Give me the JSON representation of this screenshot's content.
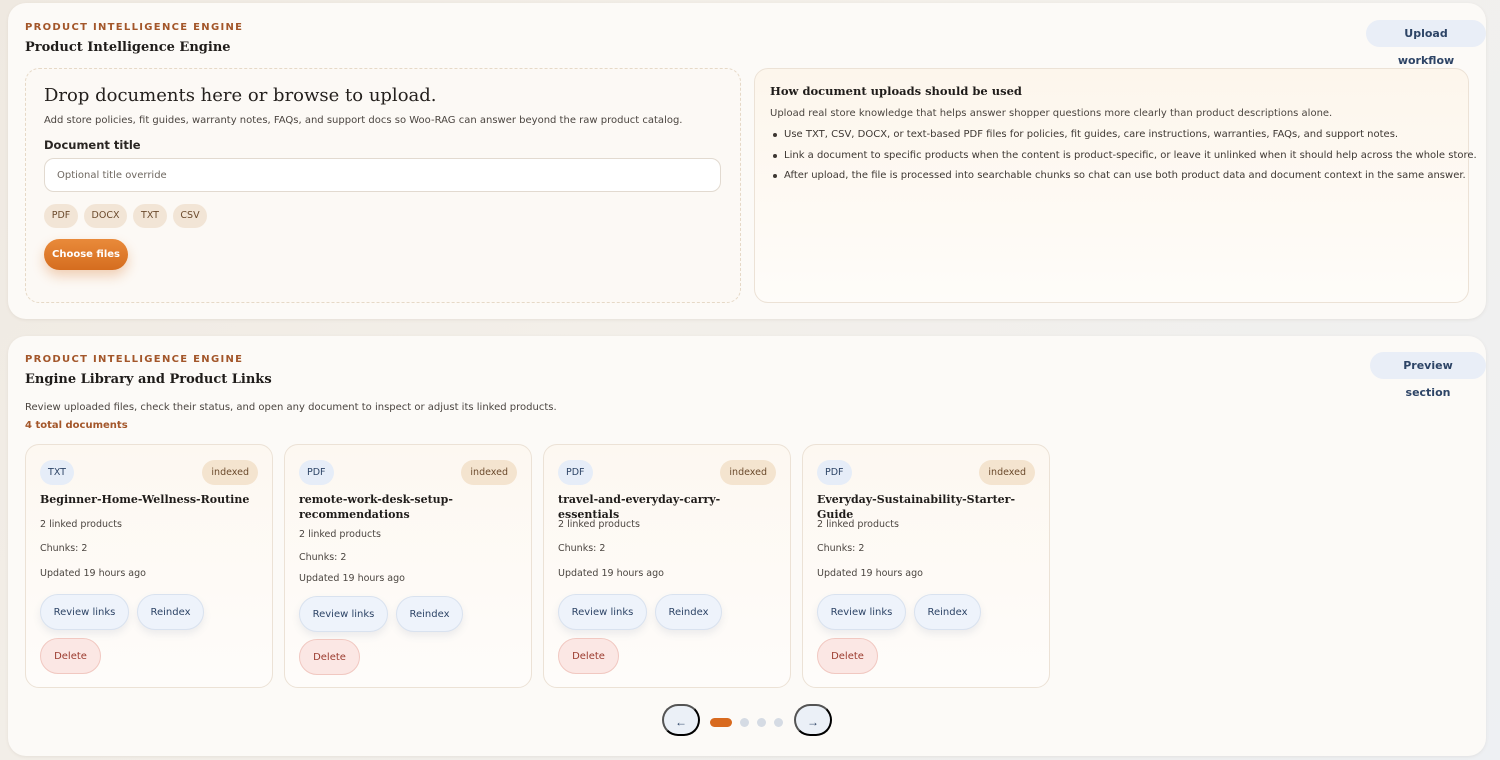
{
  "upload_panel": {
    "eyebrow": "PRODUCT INTELLIGENCE ENGINE",
    "title": "Product Intelligence Engine",
    "workflow_button": "Upload workflow",
    "dropzone": {
      "heading": "Drop documents here or browse to upload.",
      "description": "Add store policies, fit guides, warranty notes, FAQs, and support docs so Woo-RAG can answer beyond the raw product catalog.",
      "title_label": "Document title",
      "title_placeholder": "Optional title override",
      "title_value": "",
      "formats": [
        "PDF",
        "DOCX",
        "TXT",
        "CSV"
      ],
      "choose_button": "Choose files"
    },
    "info": {
      "title": "How document uploads should be used",
      "intro": "Upload real store knowledge that helps answer shopper questions more clearly than product descriptions alone.",
      "bullets": [
        "Use TXT, CSV, DOCX, or text-based PDF files for policies, fit guides, care instructions, warranties, FAQs, and support notes.",
        "Link a document to specific products when the content is product-specific, or leave it unlinked when it should help across the whole store.",
        "After upload, the file is processed into searchable chunks so chat can use both product data and document context in the same answer."
      ]
    }
  },
  "library_panel": {
    "eyebrow": "PRODUCT INTELLIGENCE ENGINE",
    "title": "Engine Library and Product Links",
    "preview_button": "Preview section",
    "description": "Review uploaded files, check their status, and open any document to inspect or adjust its linked products.",
    "total": "4 total documents",
    "documents": [
      {
        "type": "TXT",
        "status": "indexed",
        "name": "Beginner-Home-Wellness-Routine",
        "linked": "2 linked products",
        "chunks": "Chunks: 2",
        "updated": "Updated 19 hours ago"
      },
      {
        "type": "PDF",
        "status": "indexed",
        "name": "remote-work-desk-setup-recommendations",
        "linked": "2 linked products",
        "chunks": "Chunks: 2",
        "updated": "Updated 19 hours ago"
      },
      {
        "type": "PDF",
        "status": "indexed",
        "name": "travel-and-everyday-carry-essentials",
        "linked": "2 linked products",
        "chunks": "Chunks: 2",
        "updated": "Updated 19 hours ago"
      },
      {
        "type": "PDF",
        "status": "indexed",
        "name": "Everyday-Sustainability-Starter-Guide",
        "linked": "2 linked products",
        "chunks": "Chunks: 2",
        "updated": "Updated 19 hours ago"
      }
    ],
    "actions": {
      "review": "Review links",
      "reindex": "Reindex",
      "delete": "Delete"
    },
    "pagination": {
      "prev": "←",
      "next": "→",
      "pages": 4,
      "current": 1
    }
  },
  "colors": {
    "accent": "#d86a1f",
    "eyebrow": "#a3562a",
    "soft_blue": "#eef3fb",
    "danger": "#9b3b2e"
  }
}
